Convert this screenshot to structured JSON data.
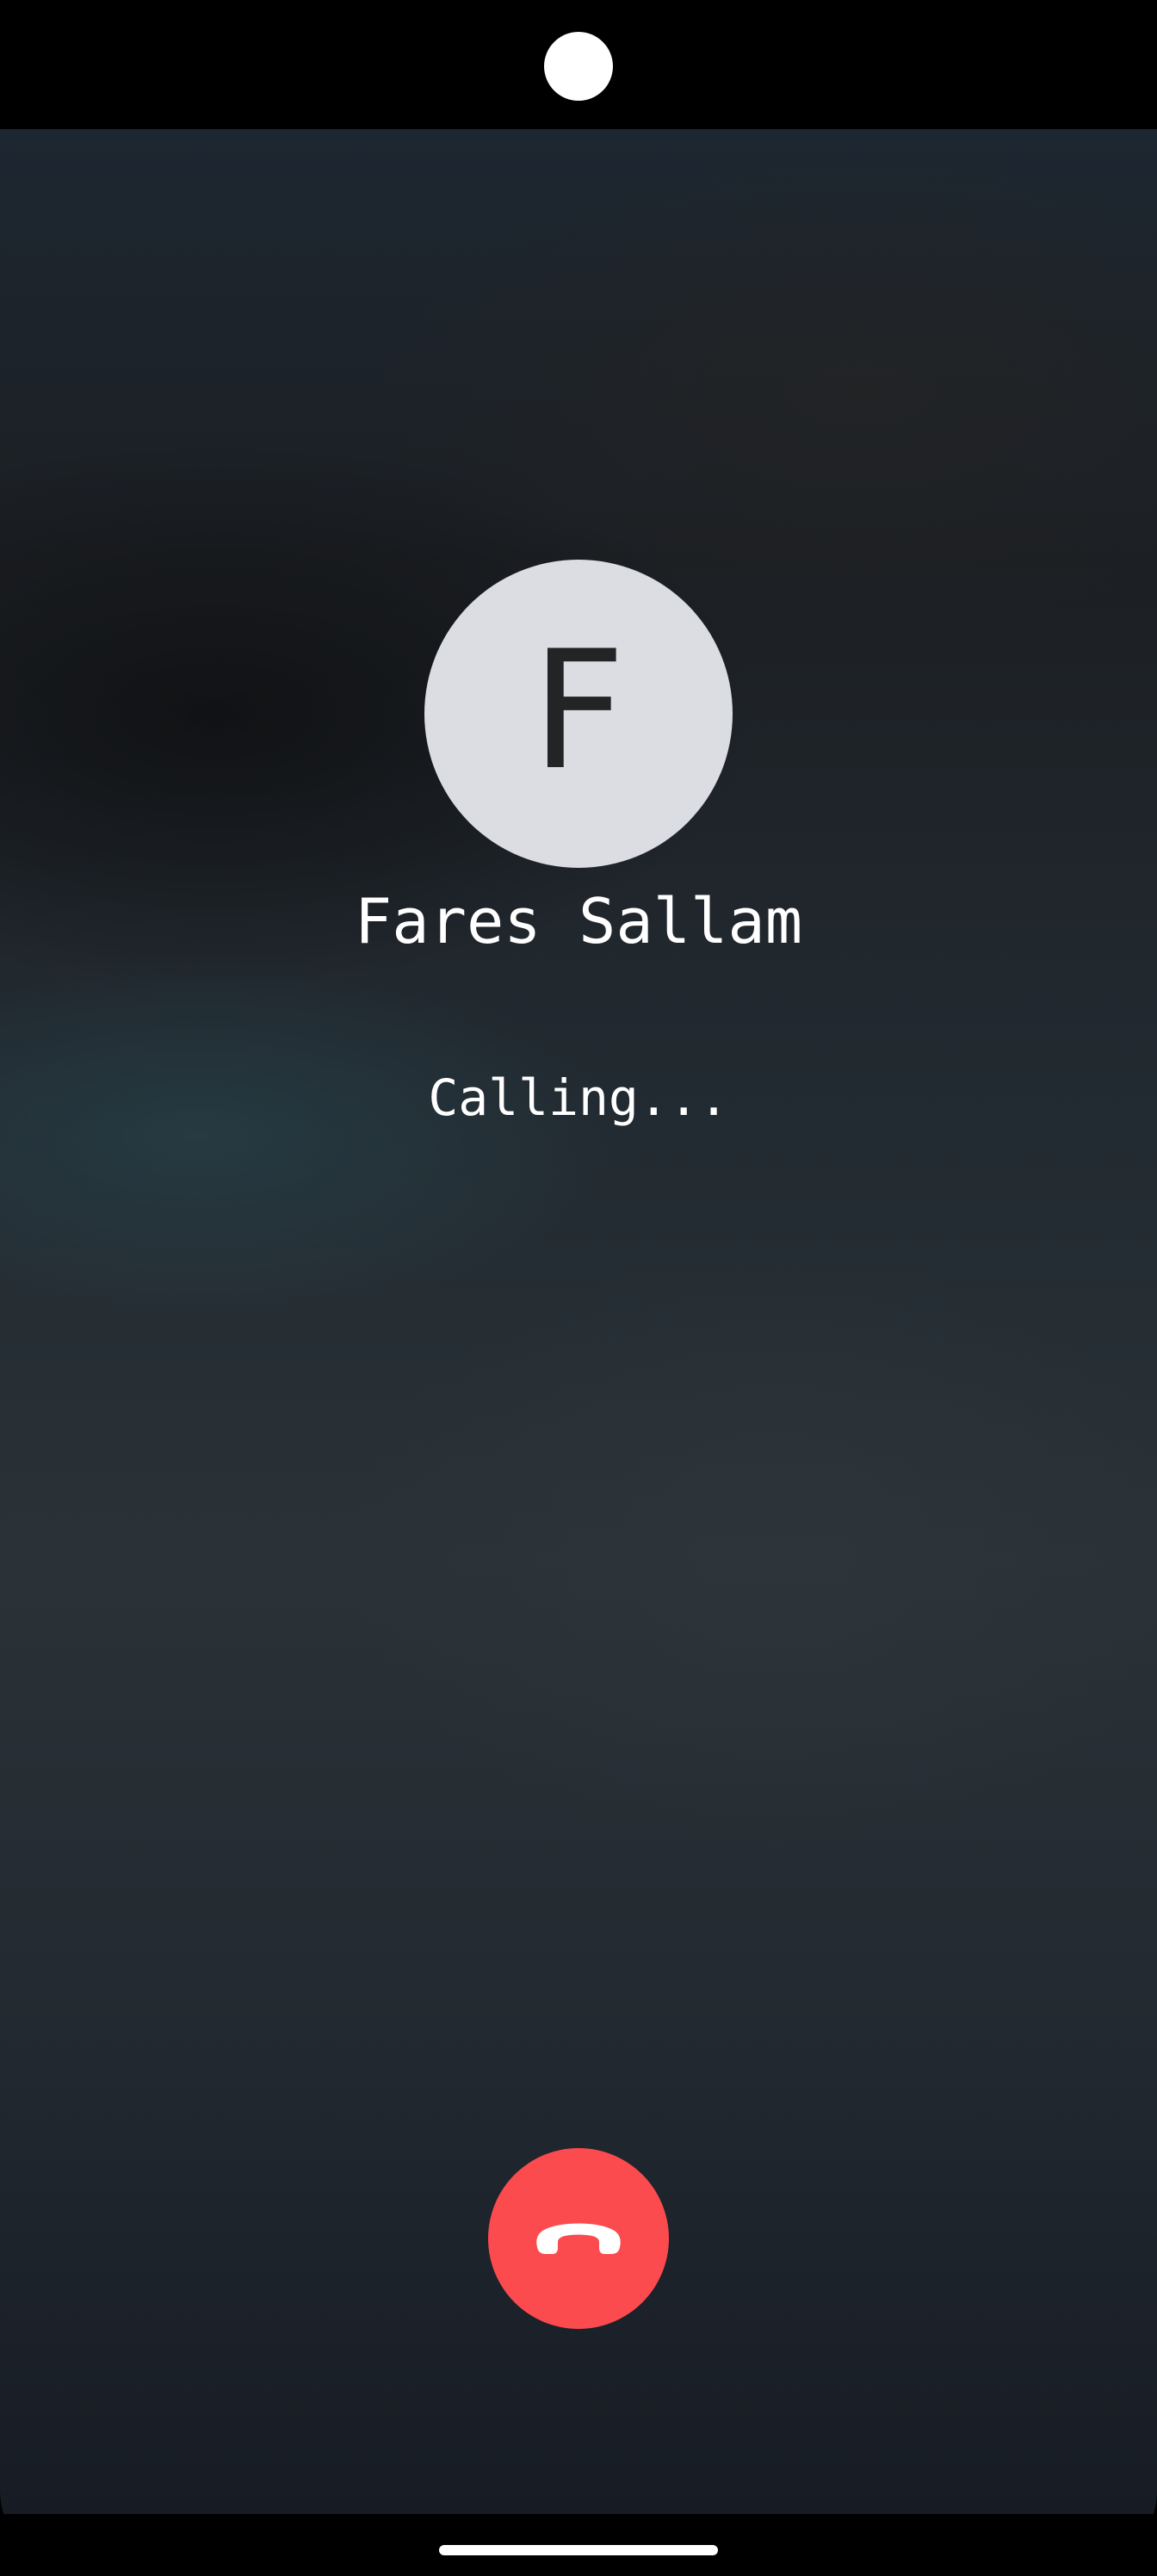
{
  "contact": {
    "initial": "F",
    "name": "Fares Sallam"
  },
  "call": {
    "status": "Calling..."
  },
  "actions": {
    "end_call_icon": "phone-hangup-icon"
  },
  "colors": {
    "end_call": "#fb4b4e",
    "avatar_bg": "#dcdde2"
  }
}
